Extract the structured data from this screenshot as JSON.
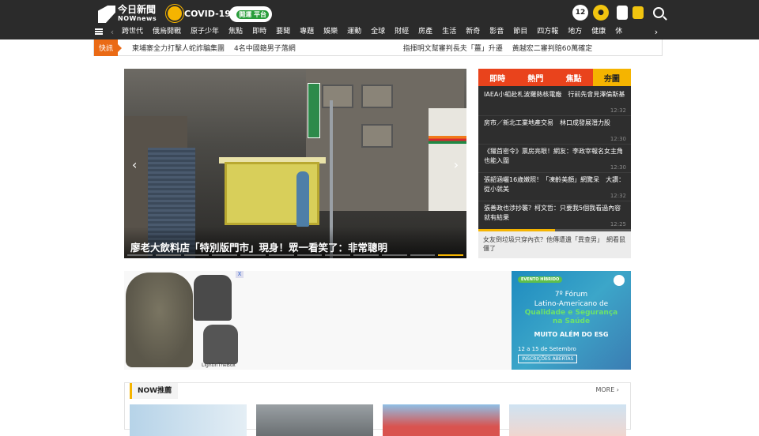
{
  "brand": {
    "logo_name": "今日新聞",
    "logo_sub": "NOWnews"
  },
  "header": {
    "covid_label": "COVID-19",
    "promo_label": "開運\n平台",
    "icons": [
      "12-icon",
      "coin-icon",
      "phone-icon",
      "mic-icon",
      "search-icon"
    ]
  },
  "nav": {
    "items": [
      "跨世代",
      "俄烏開戰",
      "原子少年",
      "焦點",
      "即時",
      "要聞",
      "專題",
      "娛樂",
      "運動",
      "全球",
      "財經",
      "房產",
      "生活",
      "新奇",
      "影音",
      "節目",
      "四方報",
      "地方",
      "健康",
      "休"
    ]
  },
  "ticker": {
    "tag": "快訊",
    "items": [
      "柬埔寨全力打擊人蛇詐騙集團",
      "4名中國籍男子落網",
      "指揮明文幫審判長夫「薑」升遷",
      "黃越宏二審判賠60萬確定"
    ]
  },
  "hero": {
    "caption": "廖老大飲料店「特別版門市」現身！眾一看笑了：非常聰明",
    "prev": "‹",
    "next": "›"
  },
  "side": {
    "tabs": [
      "即時",
      "熱門",
      "焦點",
      "夯圖"
    ],
    "items": [
      {
        "title": "IAEA小組赴札波羅熱核電廠　行前先會見澤倫斯基",
        "time": "12:32"
      },
      {
        "title": "房市／新北工業地產交易　林口成發展潛力股",
        "time": "12:30"
      },
      {
        "title": "《獵首密令》票房亮眼！網友：李政宰報名女主角也能入圍",
        "time": "12:30"
      },
      {
        "title": "張韶涵曬16歲嫩照！「凍齡美顏」網驚呆　大讚：從小就美",
        "time": "12:32"
      },
      {
        "title": "張善政也涉抄襲？柯文哲：只要我5個我看過內容就有結果",
        "time": "12:25"
      }
    ],
    "bottom": "女友倒垃圾只穿內衣？他傳遭遺「異查男」　網看鼠僵了"
  },
  "ad": {
    "brand": "LightInTheBox",
    "close": "X"
  },
  "ad2": {
    "pill": "EVENTO HÍBRIDO",
    "line1": "7º Fórum",
    "line2": "Latino-Americano de",
    "line3": "Qualidade e Segurança",
    "line4": "na Saúde",
    "line5": "MUITO ALÉM DO ESG",
    "date": "12 a 15 de Setembro",
    "cta": "INSCRIÇÕES ABERTAS"
  },
  "now": {
    "title": "NOW推薦",
    "more": "MORE ›"
  }
}
